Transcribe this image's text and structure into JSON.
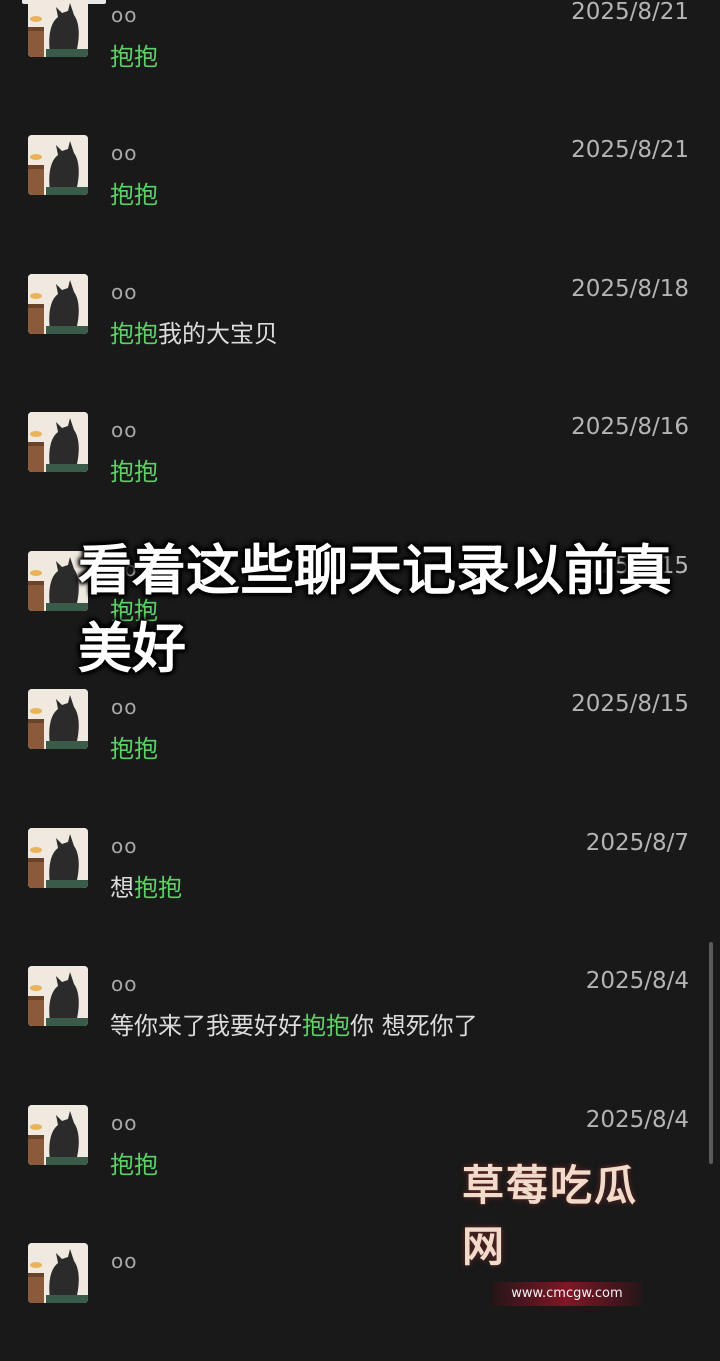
{
  "messages": [
    {
      "sender": "oo",
      "date": "2025/8/21",
      "parts": [
        {
          "text": "抱抱",
          "hl": true
        }
      ]
    },
    {
      "sender": "oo",
      "date": "2025/8/21",
      "parts": [
        {
          "text": "抱抱",
          "hl": true
        }
      ]
    },
    {
      "sender": "oo",
      "date": "2025/8/18",
      "parts": [
        {
          "text": "抱抱",
          "hl": true
        },
        {
          "text": "我的大宝贝",
          "hl": false
        }
      ]
    },
    {
      "sender": "oo",
      "date": "2025/8/16",
      "parts": [
        {
          "text": "抱抱",
          "hl": true
        }
      ]
    },
    {
      "sender": "oo",
      "date": "2025/8/15",
      "parts": [
        {
          "text": "抱抱",
          "hl": true
        }
      ]
    },
    {
      "sender": "oo",
      "date": "2025/8/15",
      "parts": [
        {
          "text": "抱抱",
          "hl": true
        }
      ]
    },
    {
      "sender": "oo",
      "date": "2025/8/7",
      "parts": [
        {
          "text": "想",
          "hl": false
        },
        {
          "text": "抱抱",
          "hl": true
        }
      ]
    },
    {
      "sender": "oo",
      "date": "2025/8/4",
      "parts": [
        {
          "text": "等你来了我要好好",
          "hl": false
        },
        {
          "text": "抱抱",
          "hl": true
        },
        {
          "text": "你 想死你了",
          "hl": false
        }
      ]
    },
    {
      "sender": "oo",
      "date": "2025/8/4",
      "parts": [
        {
          "text": "抱抱",
          "hl": true
        }
      ]
    },
    {
      "sender": "oo",
      "date": "",
      "parts": []
    }
  ],
  "overlay_caption": "看着这些聊天记录以前真美好",
  "watermark": {
    "title": "草莓吃瓜网",
    "url": "www.cmcgw.com"
  },
  "colors": {
    "background": "#191919",
    "highlight": "#5fcf6a",
    "text": "#dcdcdc"
  }
}
